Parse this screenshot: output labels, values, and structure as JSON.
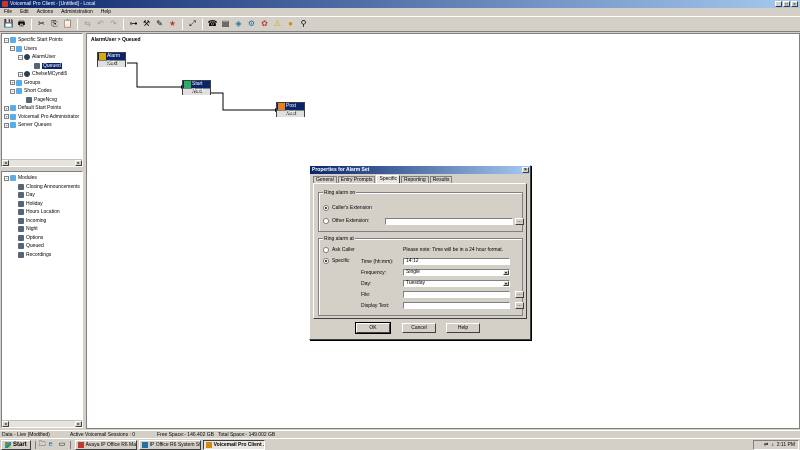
{
  "window": {
    "title": "Voicemail Pro Client - [Untitled] - Local"
  },
  "menu": [
    "File",
    "Edit",
    "Actions",
    "Administration",
    "Help"
  ],
  "toolbar": {
    "icons": [
      "save-icon",
      "print-icon",
      "cut-icon",
      "copy-icon",
      "paste-icon",
      "flow-icon",
      "undo-icon",
      "redo-icon",
      "group-icon",
      "tools-icon",
      "connect-icon",
      "goto-icon",
      "queue-icon",
      "telephony-icon",
      "database-icon",
      "condition-icon",
      "module-icon",
      "misc-icon",
      "warn-icon",
      "alarm-icon",
      "config-icon"
    ]
  },
  "tree": {
    "start_points": "Specific Start Points",
    "users": "Users",
    "alarm_user": "AlarmUser",
    "queued": "Queued",
    "other_user": "ChelseMCyndi5",
    "groups": "Groups",
    "short_codes": "Short Codes",
    "page_ncvg": "PageNcvg",
    "default_start": "Default Start Points",
    "vm_admin": "Voicemail Pro Administrator",
    "server_queues": "Server Queues"
  },
  "modules": {
    "root": "Modules",
    "items": [
      "Closing Announcements",
      "Day",
      "Holiday",
      "Hours Location",
      "Incoming",
      "Night",
      "Options",
      "Queued",
      "Recordings"
    ]
  },
  "canvas": {
    "breadcrumb": "AlarmUser > Queued",
    "actions": [
      {
        "name": "Alarm Set",
        "next": "Next"
      },
      {
        "name": "Start Point",
        "next": "Next"
      },
      {
        "name": "Post Dial",
        "next": "Next"
      }
    ]
  },
  "dialog": {
    "title": "Properties for Alarm Set",
    "tabs": [
      "General",
      "Entry Prompts",
      "Specific",
      "Reporting",
      "Results"
    ],
    "ring_on": {
      "label": "Ring alarm on",
      "callers_ext": "Caller's Extension",
      "other_ext": "Other Extension:",
      "other_value": ""
    },
    "ring_at": {
      "label": "Ring alarm at",
      "ask_caller": "Ask Caller",
      "note": "Please note: Time will be in a 24 hour format.",
      "specific": "Specific",
      "time_label": "Time (hh:mm):",
      "time_value": "14:12",
      "freq_label": "Frequency:",
      "freq_value": "Single",
      "day_label": "Day:",
      "day_value": "Tuesday",
      "file_label": "File:",
      "file_value": "",
      "display_label": "Display Text:",
      "display_value": ""
    },
    "buttons": {
      "ok": "OK",
      "cancel": "Cancel",
      "help": "Help"
    }
  },
  "status": {
    "mode": "Data - Live (Modified)",
    "sessions": "Active Voicemail Sessions : 0",
    "free": "Free Space:- 146.402 GB",
    "total": "Total Space:- 149.002 GB"
  },
  "taskbar": {
    "start": "Start",
    "tasks": [
      "Avaya IP Office R6 Man...",
      "IP Office R6 System Stat...",
      "Voicemail Pro Client ..."
    ],
    "clock": "2:11 PM"
  }
}
